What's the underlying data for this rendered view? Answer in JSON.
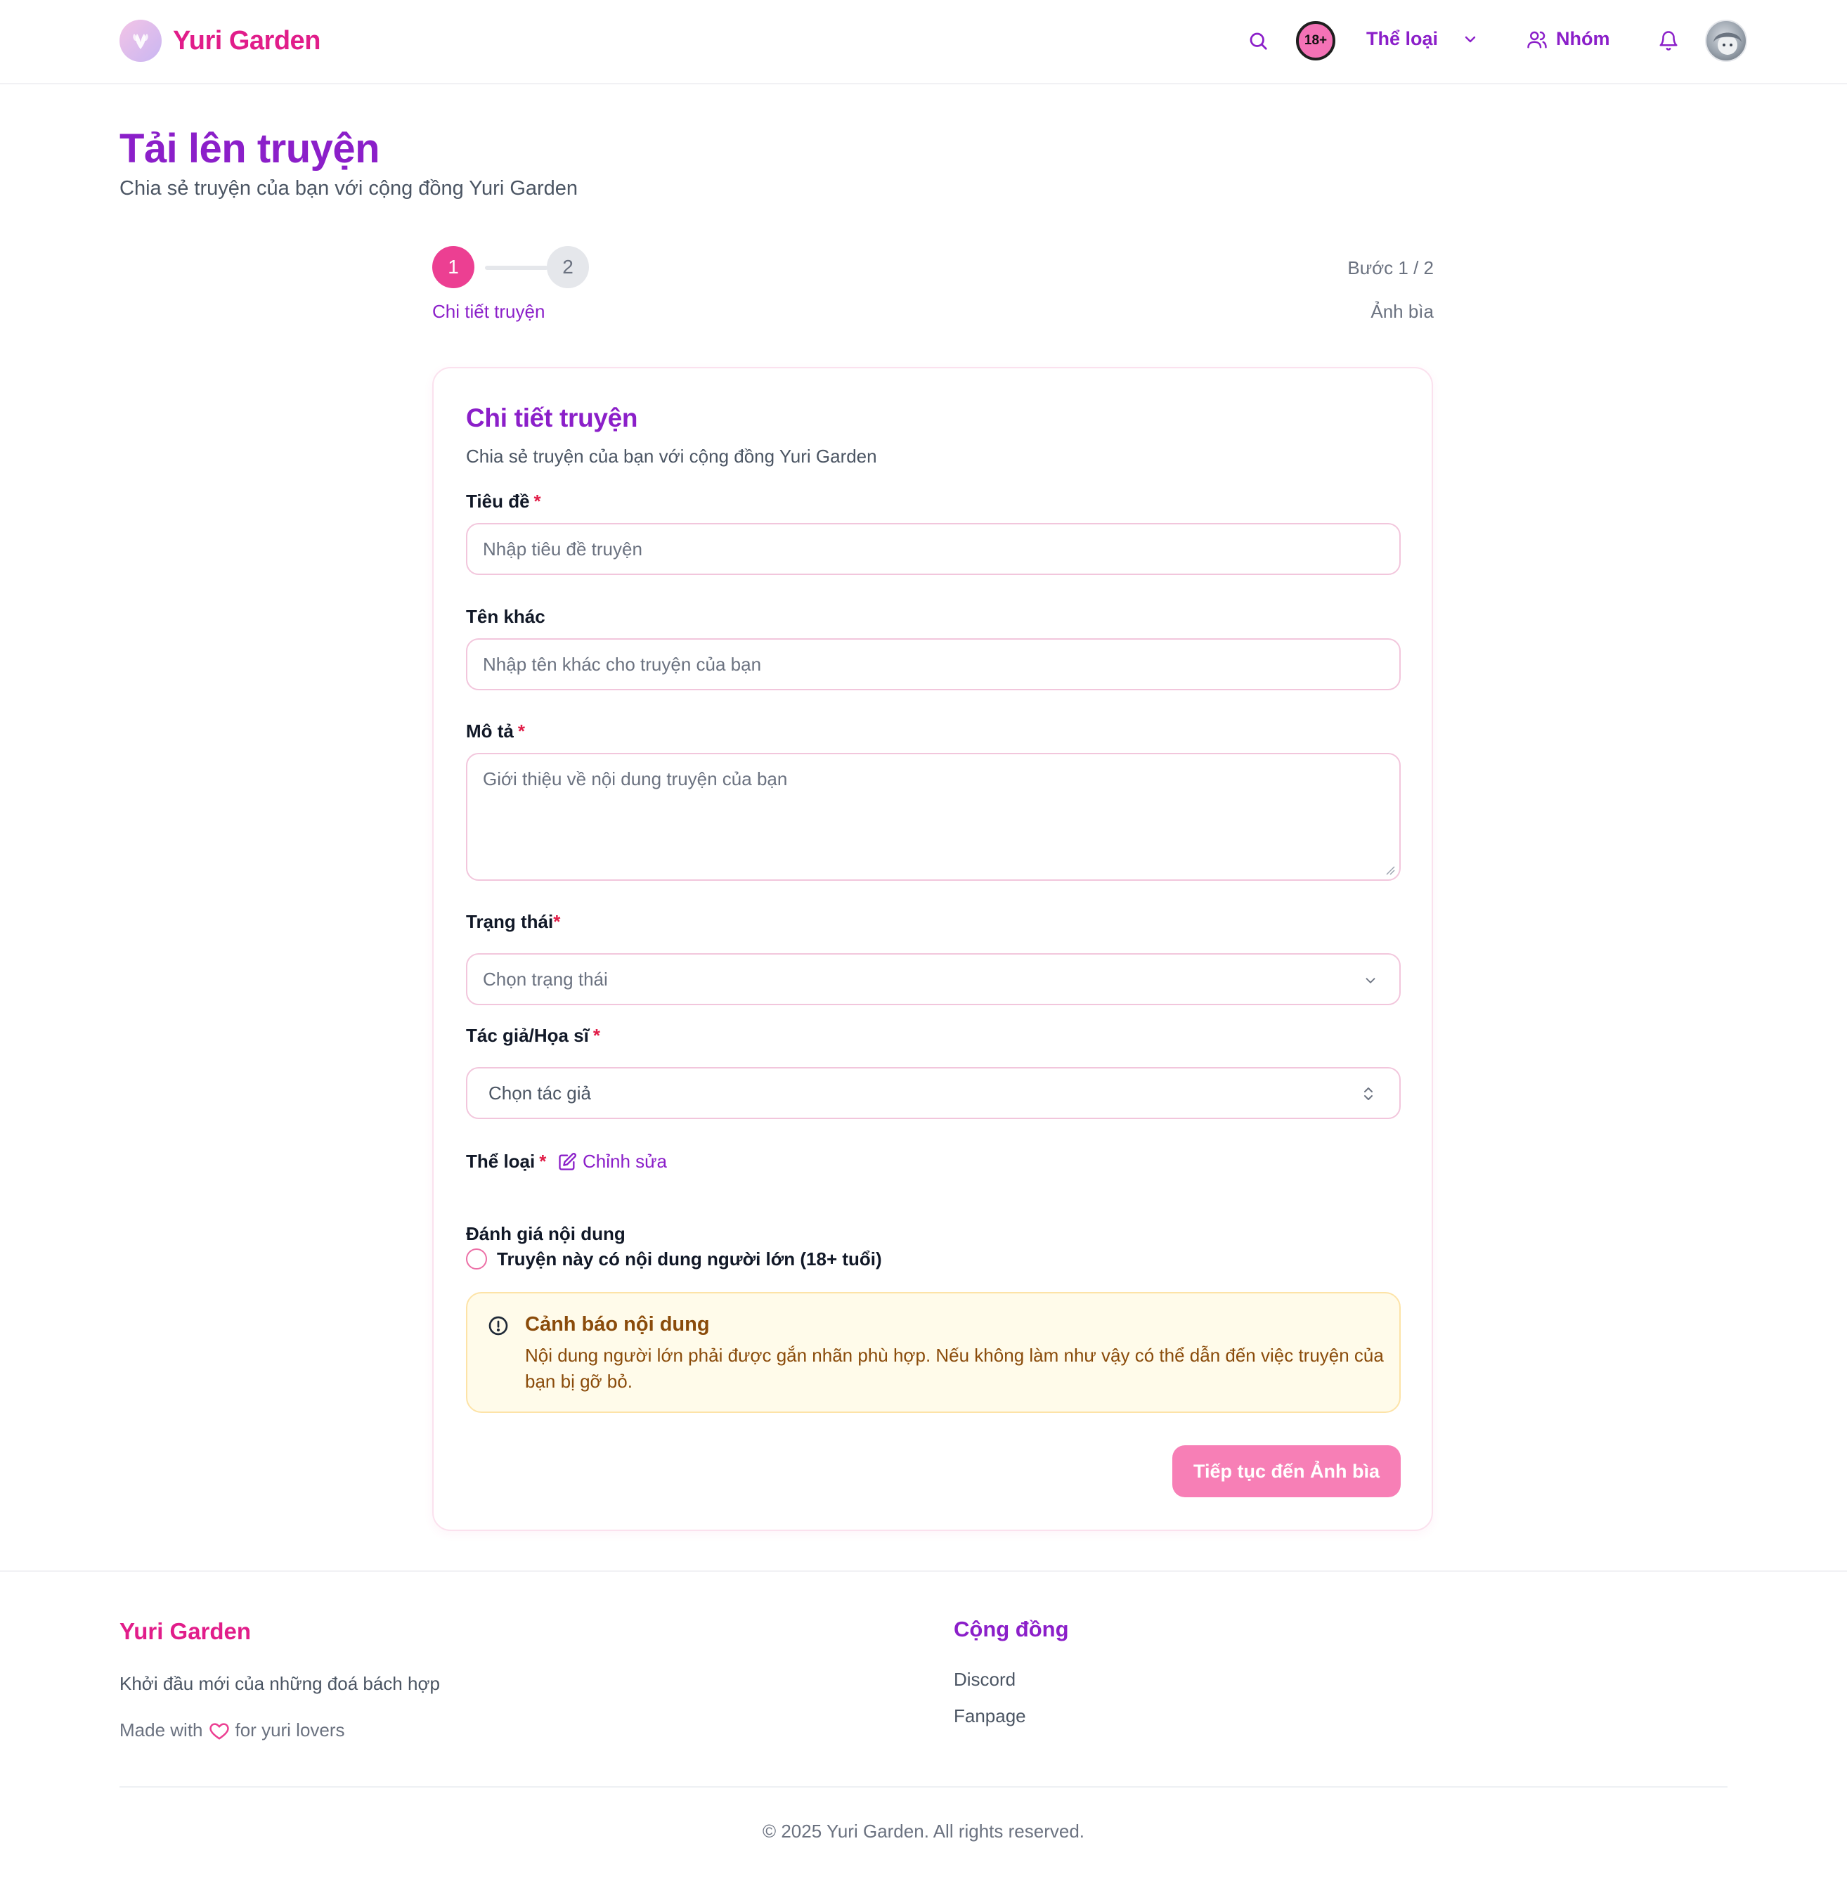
{
  "header": {
    "brand": "Yuri Garden",
    "badge_18": "18+",
    "genre_label": "Thể loại",
    "group_label": "Nhóm",
    "icons": {
      "logo": "flower-logo-icon",
      "search": "search-icon",
      "genre_dropdown": "chevron-down-icon",
      "group": "users-icon",
      "notifications": "bell-icon",
      "avatar": "user-avatar"
    }
  },
  "page": {
    "title": "Tải lên truyện",
    "subtitle": "Chia sẻ truyện của bạn với cộng đồng Yuri Garden"
  },
  "stepper": {
    "step1_number": "1",
    "step2_number": "2",
    "step1_label": "Chi tiết truyện",
    "step_count": "Bước 1 / 2",
    "step2_label": "Ảnh bìa"
  },
  "form": {
    "title": "Chi tiết truyện",
    "subtitle": "Chia sẻ truyện của bạn với cộng đồng Yuri Garden",
    "title_field": {
      "label": "Tiêu đề",
      "required_mark": "*",
      "placeholder": "Nhập tiêu đề truyện",
      "value": ""
    },
    "alt_name_field": {
      "label": "Tên khác",
      "placeholder": "Nhập tên khác cho truyện của bạn",
      "value": ""
    },
    "description_field": {
      "label": "Mô tả",
      "required_mark": "*",
      "placeholder": "Giới thiệu về nội dung truyện của bạn",
      "value": ""
    },
    "status_field": {
      "label": "Trạng thái",
      "required_mark": "*",
      "selected": "Chọn trạng thái"
    },
    "author_field": {
      "label": "Tác giả/Họa sĩ",
      "required_mark": "*",
      "selected": "Chọn tác giả"
    },
    "genre_field": {
      "label": "Thể loại",
      "required_mark": "*",
      "edit_label": "Chỉnh sửa"
    },
    "rating": {
      "title": "Đánh giá nội dung",
      "adult_label": "Truyện này có nội dung người lớn (18+ tuổi)",
      "adult_checked": false
    },
    "warning": {
      "title": "Cảnh báo nội dung",
      "text": "Nội dung người lớn phải được gắn nhãn phù hợp. Nếu không làm như vậy có thể dẫn đến việc truyện của bạn bị gỡ bỏ."
    },
    "submit_label": "Tiếp tục đến Ảnh bìa"
  },
  "footer": {
    "brand": "Yuri Garden",
    "tagline": "Khởi đầu mới của những đoá bách hợp",
    "made_with_prefix": "Made with",
    "made_with_suffix": "for yuri lovers",
    "community_title": "Cộng đồng",
    "links": [
      "Discord",
      "Fanpage"
    ],
    "copyright": "© 2025 Yuri Garden. All rights reserved."
  },
  "colors": {
    "brand_pink": "#e11d8a",
    "brand_purple": "#8b1fc9",
    "step_active": "#ec3f92",
    "button": "#f77fb6",
    "warning_bg": "#fffbea",
    "warning_text": "#8a4b0a"
  }
}
